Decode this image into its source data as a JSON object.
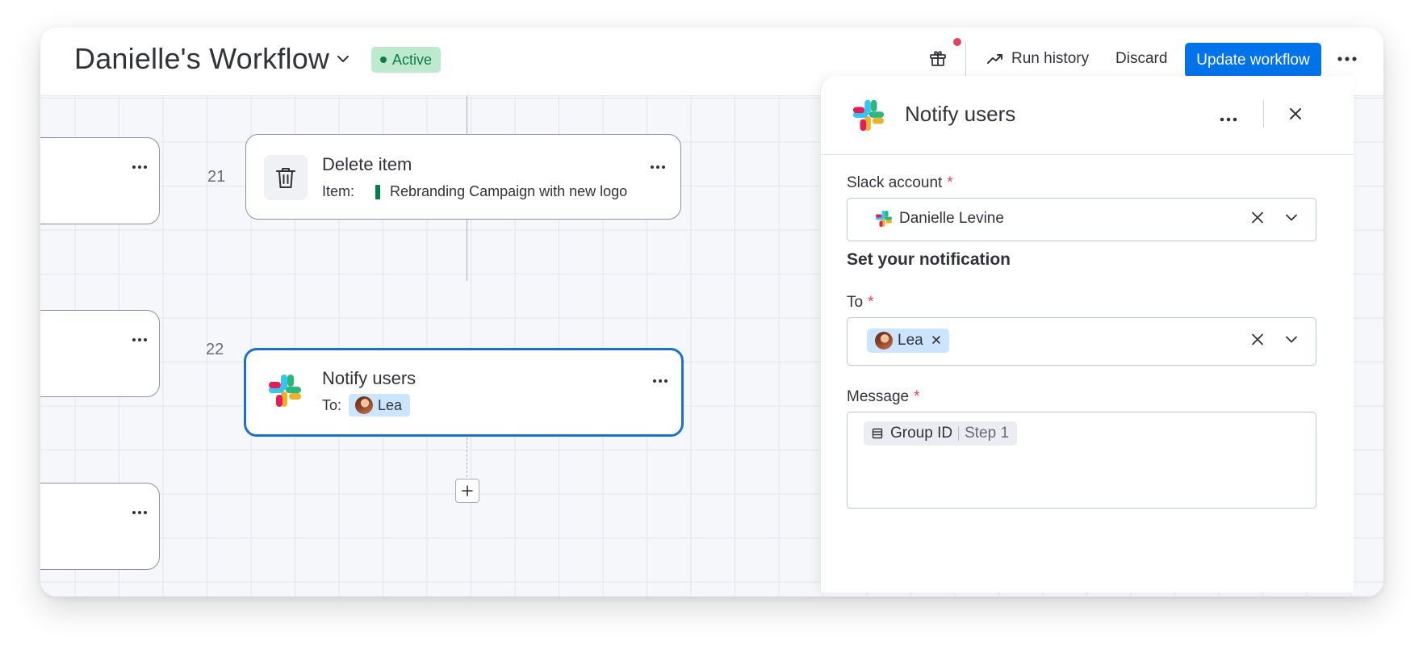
{
  "header": {
    "title": "Danielle's Workflow",
    "status": "Active",
    "run_history": "Run history",
    "discard": "Discard",
    "update": "Update workflow"
  },
  "canvas": {
    "nodes": [
      {
        "step": "21",
        "title": "Delete item",
        "line_label": "Item:",
        "item_name": "Rebranding Campaign with new logo",
        "item_color": "#037f4c"
      },
      {
        "step": "22",
        "title": "Notify users",
        "line_label": "To:",
        "recipient": "Lea"
      }
    ]
  },
  "panel": {
    "title": "Notify users",
    "slack_account": {
      "label": "Slack account",
      "required": "*",
      "value": "Danielle Levine"
    },
    "section": "Set your notification",
    "to": {
      "label": "To",
      "required": "*",
      "recipient": "Lea"
    },
    "message": {
      "label": "Message",
      "required": "*",
      "token_name": "Group ID",
      "token_step": "Step 1"
    }
  },
  "colors": {
    "accent": "#0073ea",
    "selected_border": "#1f6fd1",
    "active_badge": "#bdeacf",
    "notification_dot": "#e2445c"
  },
  "icons": [
    "chevron-down-icon",
    "gift-icon",
    "trend-icon",
    "more-icon",
    "trash-icon",
    "slack-icon",
    "close-icon",
    "plus-icon",
    "table-icon"
  ]
}
